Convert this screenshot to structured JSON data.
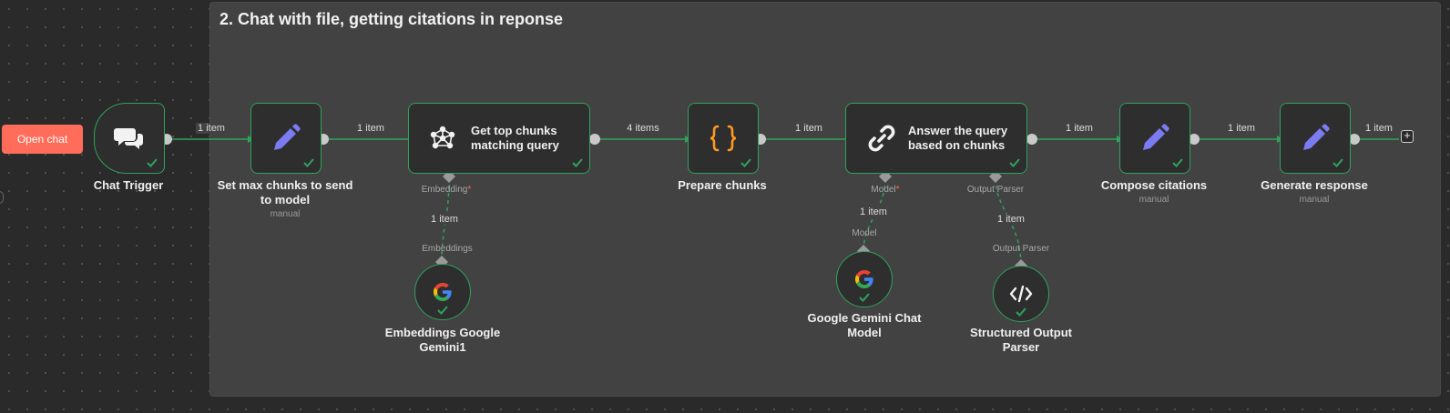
{
  "sticky_note": {
    "title": "2. Chat with file, getting citations in reponse"
  },
  "open_chat_button": "Open chat",
  "nodes": {
    "chat_trigger": {
      "title": "Chat Trigger"
    },
    "set_max_chunks": {
      "title_line1": "Set max chunks to send",
      "title_line2": "to model",
      "subtitle": "manual"
    },
    "get_top_chunks": {
      "label_line1": "Get top chunks",
      "label_line2": "matching query",
      "port_label": "Embedding",
      "required_mark": "*"
    },
    "prepare_chunks": {
      "title": "Prepare chunks"
    },
    "answer_query": {
      "label_line1": "Answer the query",
      "label_line2": "based on chunks",
      "port_model": "Model",
      "required_mark": "*",
      "port_parser": "Output Parser"
    },
    "compose_citations": {
      "title": "Compose citations",
      "subtitle": "manual"
    },
    "generate_response": {
      "title": "Generate response",
      "subtitle": "manual"
    },
    "embeddings_gemini": {
      "title_line1": "Embeddings Google",
      "title_line2": "Gemini1",
      "port_label": "Embeddings"
    },
    "gemini_chat_model": {
      "title_line1": "Google Gemini Chat",
      "title_line2": "Model",
      "port_label": "Model"
    },
    "structured_output_parser": {
      "title_line1": "Structured Output",
      "title_line2": "Parser",
      "port_label": "Output Parser"
    }
  },
  "edges": {
    "e1": "1 item",
    "e2": "1 item",
    "e3": "4 items",
    "e4": "1 item",
    "e5": "1 item",
    "e6": "1 item",
    "e7": "1 item",
    "sub_embeddings": "1 item",
    "sub_model": "1 item",
    "sub_parser": "1 item"
  },
  "icons": {
    "chat_trigger": "chat-bubbles-icon",
    "set_nodes": "pencil-icon",
    "vector_store": "vector-store-icon",
    "code": "curly-braces-icon",
    "chain": "link-chain-icon",
    "gemini": "google-g-icon",
    "parser": "code-brackets-icon",
    "success": "checkmark-icon",
    "add": "plus-icon"
  },
  "colors": {
    "canvas": "#2a2a2a",
    "sticky": "#424242",
    "success_green": "#2fa35a",
    "accent_orange": "#ff6d5a",
    "pencil_purple": "#7b7bf2",
    "code_orange": "#ff9922"
  }
}
